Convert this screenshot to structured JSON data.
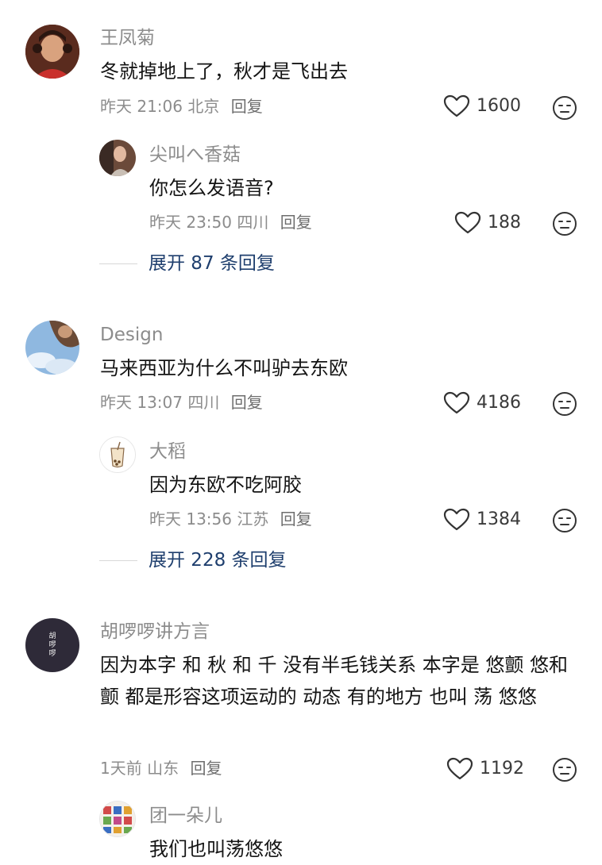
{
  "comments": [
    {
      "user": "王凤菊",
      "text": "冬就掉地上了，秋才是飞出去",
      "time": "昨天 21:06",
      "location": "北京",
      "reply_label": "回复",
      "likes": "1600",
      "replies": [
        {
          "user": "尖叫へ香菇",
          "text": "你怎么发语音?",
          "time": "昨天 23:50",
          "location": "四川",
          "reply_label": "回复",
          "likes": "188"
        }
      ],
      "expand_label": "展开 87 条回复"
    },
    {
      "user": "Design",
      "text": "马来西亚为什么不叫驴去东欧",
      "time": "昨天 13:07",
      "location": "四川",
      "reply_label": "回复",
      "likes": "4186",
      "replies": [
        {
          "user": "大稻",
          "text": "因为东欧不吃阿胶",
          "time": "昨天 13:56",
          "location": "江苏",
          "reply_label": "回复",
          "likes": "1384"
        }
      ],
      "expand_label": "展开 228 条回复"
    },
    {
      "user": "胡啰啰讲方言",
      "text": "因为本字 和 秋 和 千 没有半毛钱关系  本字是 悠颤 悠和颤 都是形容这项运动的 动态 有的地方 也叫 荡 悠悠",
      "time": "1天前",
      "location": "山东",
      "reply_label": "回复",
      "likes": "1192",
      "avatar_text": "胡啰啰",
      "replies": [
        {
          "user": "团一朵儿",
          "text": "我们也叫荡悠悠"
        }
      ]
    }
  ],
  "icons": {
    "like": "heart-outline-icon",
    "dislike": "neutral-face-icon"
  },
  "colors": {
    "name_gray": "#8c8c8c",
    "expand_blue": "#1f3f6e",
    "text_dark": "#141414"
  }
}
